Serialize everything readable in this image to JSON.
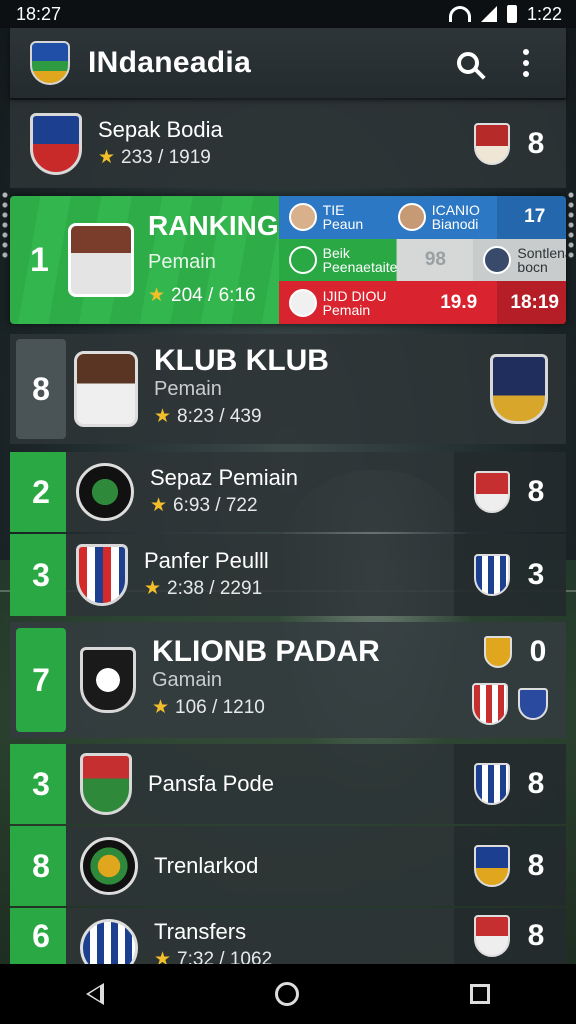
{
  "status": {
    "time_left": "18:27",
    "time_right": "1:22"
  },
  "app": {
    "title": "INdaneadia"
  },
  "top_club": {
    "name": "Sepak Bodia",
    "rating": "233 / 1919",
    "score": "8"
  },
  "ranking_card": {
    "rank": "1",
    "title": "RANKING",
    "sub": "Pemain",
    "rating": "204 / 6:16",
    "lines": [
      {
        "a": "TIE",
        "a2": "Peaun",
        "b": "ICANIO",
        "b2": "Bianodi",
        "value": "17"
      },
      {
        "a": "Beik",
        "a2": "Peenaetaite",
        "b": "Sontlena",
        "b2": "bocn",
        "value": "98"
      },
      {
        "a": "IJID DIOU",
        "a2": "Pemain",
        "value": "19.9",
        "value2": "18:19"
      }
    ]
  },
  "featured": {
    "rank": "8",
    "name": "KLUB KLUB",
    "sub": "Pemain",
    "rating": "8:23 / 439"
  },
  "rows": [
    {
      "rank": "2",
      "name": "Sepaz Pemiain",
      "rating": "6:93 / 722",
      "score": "8"
    },
    {
      "rank": "3",
      "name": "Panfer Peulll",
      "rating": "2:38 / 2291",
      "score": "3"
    }
  ],
  "featured2": {
    "rank": "7",
    "name": "KLIONB PADAR",
    "sub": "Gamain",
    "rating": "106 / 1210",
    "score": "0"
  },
  "rows2": [
    {
      "rank": "3",
      "name": "Pansfa Pode",
      "score": "8"
    },
    {
      "rank": "8",
      "name": "Trenlarkod",
      "score": "8"
    },
    {
      "rank": "6",
      "name": "Transfers",
      "rating": "7:32 / 1062",
      "score": "8"
    }
  ],
  "colors": {
    "accent_green": "#2aa844",
    "blue": "#2c78c4",
    "red": "#d9232e",
    "star": "#f2bf2a"
  },
  "icons": [
    "wifi-icon",
    "signal-icon",
    "battery-icon",
    "search-icon",
    "more-icon",
    "back-icon",
    "home-icon",
    "recents-icon"
  ]
}
